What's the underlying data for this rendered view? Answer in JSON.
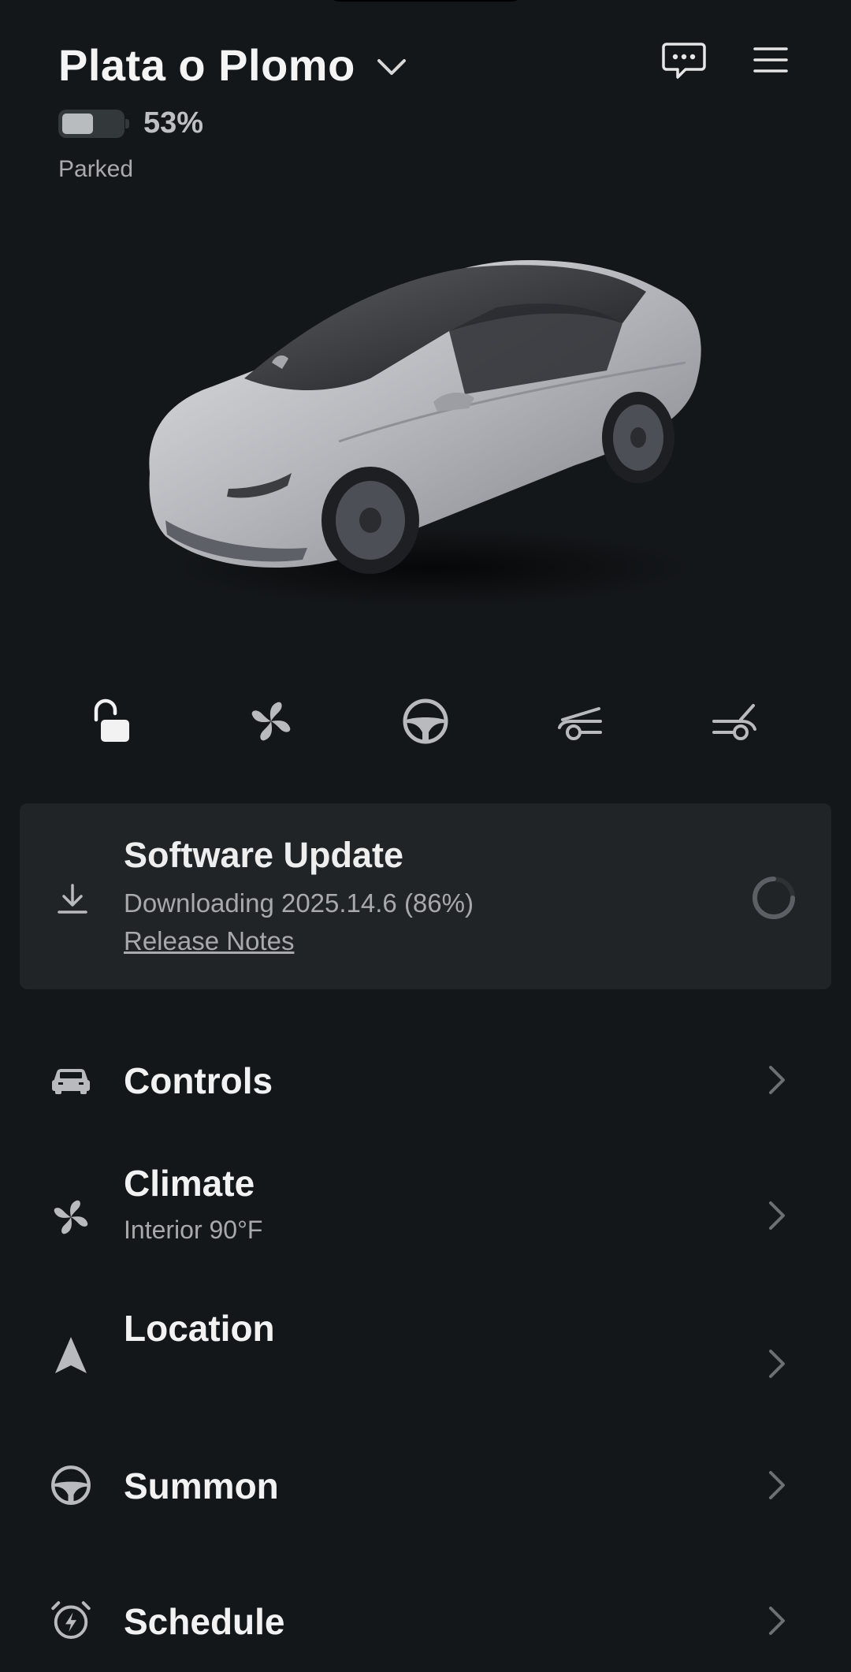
{
  "header": {
    "vehicle_name": "Plata o Plomo",
    "battery_percent": "53%",
    "battery_level": 0.53,
    "status": "Parked",
    "icons": [
      "chevron-down-icon",
      "chat-icon",
      "menu-icon"
    ]
  },
  "car_image": {
    "description_icon": "car-image",
    "color": "#b4b6bb"
  },
  "quick_actions": [
    {
      "icon": "unlock-icon"
    },
    {
      "icon": "fan-icon"
    },
    {
      "icon": "steering-wheel-icon"
    },
    {
      "icon": "frunk-icon"
    },
    {
      "icon": "trunk-icon"
    }
  ],
  "software_update": {
    "title": "Software Update",
    "subtitle": "Downloading 2025.14.6 (86%)",
    "link": "Release Notes",
    "icon": "download-icon",
    "progress_percent": 86
  },
  "menu": {
    "controls": {
      "label": "Controls",
      "icon": "car-icon"
    },
    "climate": {
      "label": "Climate",
      "sub": "Interior 90°F",
      "icon": "fan-icon"
    },
    "location": {
      "label": "Location",
      "icon": "navigation-arrow-icon"
    },
    "summon": {
      "label": "Summon",
      "icon": "steering-wheel-icon"
    },
    "schedule": {
      "label": "Schedule",
      "icon": "alarm-clock-icon"
    }
  },
  "colors": {
    "background": "#141719",
    "card": "#202426",
    "text_primary": "#f2f2f2",
    "text_secondary": "#a7a9ab"
  }
}
